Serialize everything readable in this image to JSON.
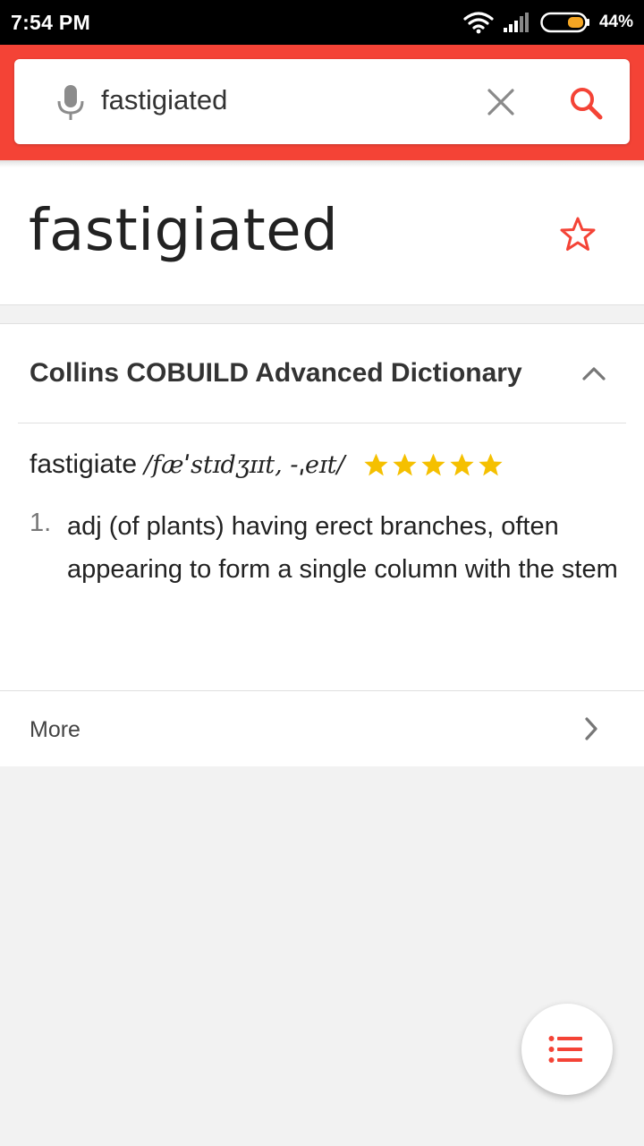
{
  "status_bar": {
    "time": "7:54 PM",
    "battery_percent": "44%",
    "battery_level": 0.44,
    "icons": [
      "wifi-icon",
      "signal-icon",
      "battery-icon"
    ]
  },
  "search": {
    "query": "fastigiated",
    "icons": [
      "mic-icon",
      "clear-icon",
      "search-icon"
    ]
  },
  "entry": {
    "word": "fastigiated",
    "favorite_icon": "star-outline-icon"
  },
  "dictionary": {
    "title": "Collins COBUILD Advanced Dictionary",
    "collapse_icon": "chevron-up-icon",
    "headword": "fastigiate",
    "pronunciation": "/fæˈstɪdʒɪɪt, -ˌeɪt/",
    "rating": 5,
    "definitions": [
      {
        "number": "1.",
        "text": "adj (of plants) having erect branches, often appearing to form a single column with the stem"
      }
    ],
    "more_label": "More",
    "more_icon": "chevron-right-icon"
  },
  "fab": {
    "icon": "list-icon"
  },
  "colors": {
    "accent": "#f44336",
    "star_gold": "#f5c000",
    "battery_fill": "#f5a623"
  }
}
